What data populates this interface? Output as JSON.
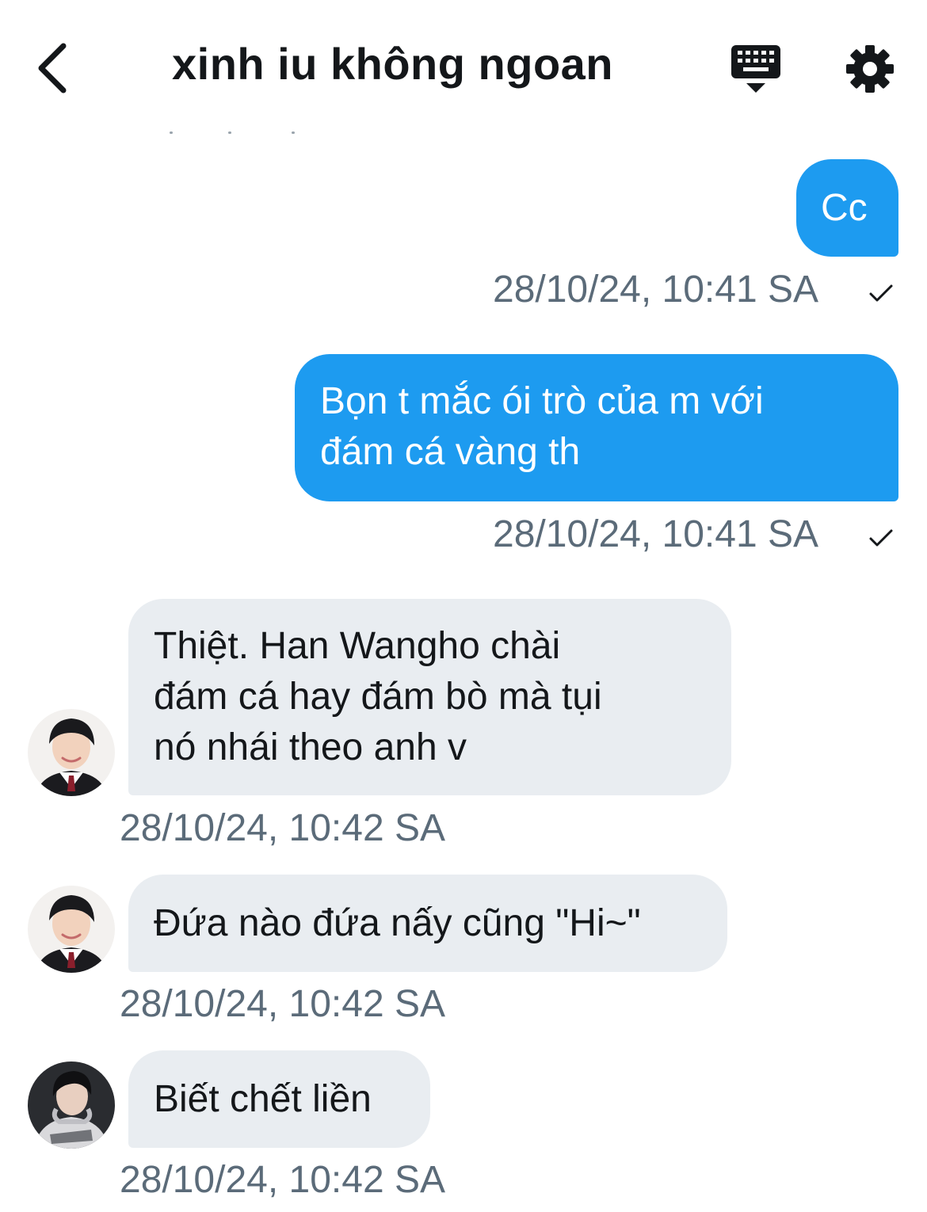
{
  "header": {
    "title": "xinh iu không ngoan",
    "back_icon": "chevron-left-icon",
    "keyboard_icon": "keyboard-icon",
    "settings_icon": "gear-icon"
  },
  "colors": {
    "outgoing_bubble": "#1d9bf0",
    "incoming_bubble": "#e9edf1",
    "timestamp": "#5b6b79"
  },
  "messages": [
    {
      "direction": "outgoing",
      "lines": [
        "Cc"
      ],
      "timestamp": "28/10/24, 10:41 SA",
      "status_icon": "check-icon"
    },
    {
      "direction": "outgoing",
      "lines": [
        "Bọn t mắc ói trò của m với",
        "đám cá vàng th"
      ],
      "timestamp": "28/10/24, 10:41 SA",
      "status_icon": "check-icon"
    },
    {
      "direction": "incoming",
      "lines": [
        "Thiệt. Han Wangho chài",
        "đám cá hay đám bò mà tụi",
        "nó nhái theo anh v"
      ],
      "timestamp": "28/10/24, 10:42 SA",
      "avatar_icon": "avatar-user-1"
    },
    {
      "direction": "incoming",
      "lines": [
        "Đứa nào đứa nấy cũng \"Hi~\""
      ],
      "timestamp": "28/10/24, 10:42 SA",
      "avatar_icon": "avatar-user-1"
    },
    {
      "direction": "incoming",
      "lines": [
        "Biết chết liền"
      ],
      "timestamp": "28/10/24, 10:42 SA",
      "avatar_icon": "avatar-user-2"
    }
  ]
}
